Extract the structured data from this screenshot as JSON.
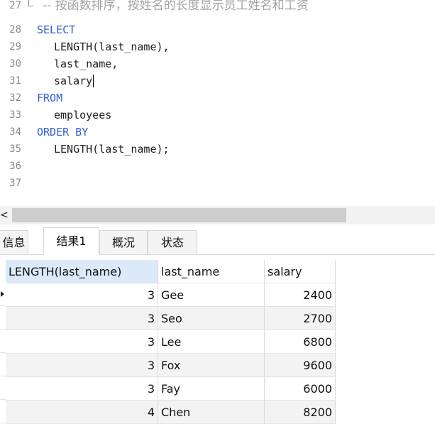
{
  "editor": {
    "comment_line": {
      "num": "27",
      "text": "-- 按函数排序，按姓名的长度显示员工姓名和工资"
    },
    "lines": [
      {
        "num": "28",
        "text": "SELECT",
        "keyword": true,
        "indent": false
      },
      {
        "num": "29",
        "text": "LENGTH(last_name),",
        "keyword": false,
        "indent": true
      },
      {
        "num": "30",
        "text": "last_name,",
        "keyword": false,
        "indent": true
      },
      {
        "num": "31",
        "text": "salary",
        "keyword": false,
        "indent": true
      },
      {
        "num": "32",
        "text": "FROM",
        "keyword": true,
        "indent": false
      },
      {
        "num": "33",
        "text": "employees",
        "keyword": false,
        "indent": true
      },
      {
        "num": "34",
        "text": "ORDER BY",
        "keyword": true,
        "indent": false
      },
      {
        "num": "35",
        "text": "LENGTH(last_name);",
        "keyword": false,
        "indent": true
      },
      {
        "num": "36",
        "text": "",
        "keyword": false,
        "indent": false
      },
      {
        "num": "37",
        "text": "",
        "keyword": false,
        "indent": false
      }
    ]
  },
  "scrollbar": {
    "left_arrow": "<"
  },
  "tabs": [
    {
      "label": "信息",
      "active": false
    },
    {
      "label": "结果1",
      "active": true
    },
    {
      "label": "概况",
      "active": false
    },
    {
      "label": "状态",
      "active": false
    }
  ],
  "grid": {
    "columns": [
      "LENGTH(last_name)",
      "last_name",
      "salary"
    ],
    "rows": [
      [
        "3",
        "Gee",
        "2400"
      ],
      [
        "3",
        "Seo",
        "2700"
      ],
      [
        "3",
        "Lee",
        "6800"
      ],
      [
        "3",
        "Fox",
        "9600"
      ],
      [
        "3",
        "Fay",
        "6000"
      ],
      [
        "4",
        "Chen",
        "8200"
      ]
    ]
  }
}
